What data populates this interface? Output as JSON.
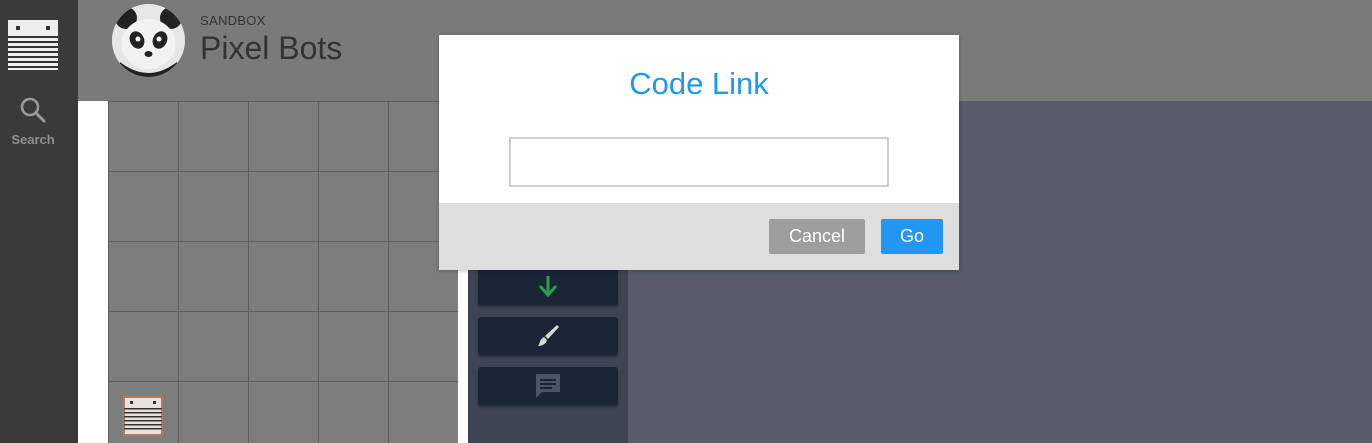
{
  "nav": {
    "search_label": "Search"
  },
  "header": {
    "section_label": "SANDBOX",
    "title": "Pixel Bots"
  },
  "grid": {
    "columns": 5,
    "rows": 5,
    "bot_cell": 20
  },
  "toolbox": {
    "visible_tools": [
      "down-arrow-icon",
      "paintbrush-icon",
      "comment-icon"
    ]
  },
  "modal": {
    "title": "Code Link",
    "input_value": "",
    "input_placeholder": "",
    "cancel_label": "Cancel",
    "go_label": "Go"
  },
  "colors": {
    "accent": "#2196f3",
    "down_arrow": "#2e9e4a",
    "nav_bg": "#3a3a3a",
    "toolbox_bg": "#3d4452",
    "tool_btn_bg": "#1a2536"
  }
}
